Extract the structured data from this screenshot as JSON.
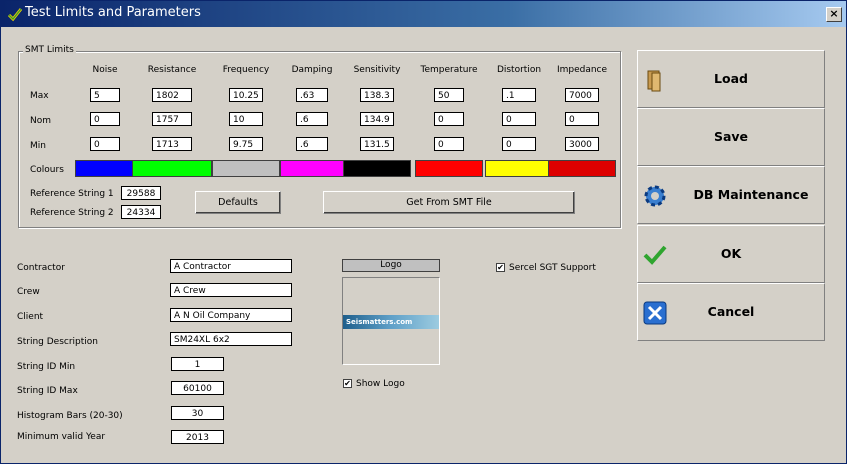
{
  "window": {
    "title": "Test Limits and Parameters",
    "close_label": "×"
  },
  "smt": {
    "group_title": "SMT Limits",
    "columns": [
      "Noise",
      "Resistance",
      "Frequency",
      "Damping",
      "Sensitivity",
      "Temperature",
      "Distortion",
      "Impedance"
    ],
    "row_labels": {
      "max": "Max",
      "nom": "Nom",
      "min": "Min",
      "colours": "Colours"
    },
    "max": [
      "5",
      "1802",
      "10.25",
      ".63",
      "138.3",
      "50",
      ".1",
      "7000"
    ],
    "nom": [
      "0",
      "1757",
      "10",
      ".6",
      "134.9",
      "0",
      "0",
      "0"
    ],
    "min": [
      "0",
      "1713",
      "9.75",
      ".6",
      "131.5",
      "0",
      "0",
      "3000"
    ],
    "colours": [
      "#0000ff",
      "#00ff00",
      "#c0c0c0",
      "#ff00ff",
      "#000000",
      "#ff0000",
      "#ffff00",
      "#dd0000"
    ],
    "ref1_label": "Reference String 1",
    "ref1_value": "29588",
    "ref2_label": "Reference String 2",
    "ref2_value": "24334",
    "defaults_label": "Defaults",
    "get_from_file_label": "Get From SMT File"
  },
  "form": {
    "contractor_label": "Contractor",
    "contractor": "A Contractor",
    "crew_label": "Crew",
    "crew": "A Crew",
    "client_label": "Client",
    "client": "A N Oil Company",
    "string_desc_label": "String Description",
    "string_desc": "SM24XL 6x2",
    "string_id_min_label": "String ID Min",
    "string_id_min": "1",
    "string_id_max_label": "String ID Max",
    "string_id_max": "60100",
    "histogram_label": "Histogram Bars (20-30)",
    "histogram": "30",
    "min_year_label": "Minimum valid Year",
    "min_year": "2013"
  },
  "logo": {
    "header": "Logo",
    "image_text": "Seismatters.com",
    "show_logo_label": "Show Logo",
    "show_logo_checked": "✔"
  },
  "sercel": {
    "label": "Sercel SGT Support",
    "checked": "✔"
  },
  "actions": {
    "load": "Load",
    "save": "Save",
    "db": "DB Maintenance",
    "ok": "OK",
    "cancel": "Cancel"
  }
}
